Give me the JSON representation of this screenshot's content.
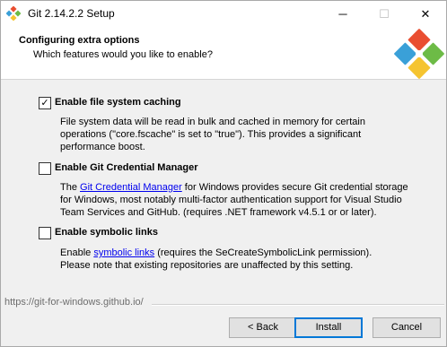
{
  "window": {
    "title": "Git 2.14.2.2 Setup",
    "minimize_glyph": "─",
    "maximize_glyph": "☐",
    "close_glyph": "✕"
  },
  "header": {
    "title": "Configuring extra options",
    "subtitle": "Which features would you like to enable?"
  },
  "options": [
    {
      "label": "Enable file system caching",
      "checked": true,
      "desc_lines": [
        "File system data will be read in bulk and cached in memory for certain",
        "operations (\"core.fscache\" is set to \"true\"). This provides a significant",
        "performance boost."
      ]
    },
    {
      "label": "Enable Git Credential Manager",
      "checked": false,
      "desc_pre": "The ",
      "desc_link": "Git Credential Manager",
      "desc_post": " for Windows provides secure Git credential storage",
      "desc_lines": [
        "for Windows, most notably multi-factor authentication support for Visual Studio",
        "Team Services and GitHub. (requires .NET framework v4.5.1 or or later)."
      ]
    },
    {
      "label": "Enable symbolic links",
      "checked": false,
      "desc_pre": "Enable ",
      "desc_link": "symbolic links",
      "desc_post": " (requires the SeCreateSymbolicLink permission).",
      "desc_lines": [
        "Please note that existing repositories are unaffected by this setting."
      ]
    }
  ],
  "footer": {
    "url": "https://git-for-windows.github.io/",
    "back_label": "< Back",
    "install_label": "Install",
    "cancel_label": "Cancel"
  },
  "colors": {
    "accent": "#0078d7",
    "link": "#0000ee",
    "git_red": "#e94e31",
    "git_green": "#6dbb46",
    "git_blue": "#3aa0d8",
    "git_yellow": "#f5c430"
  }
}
